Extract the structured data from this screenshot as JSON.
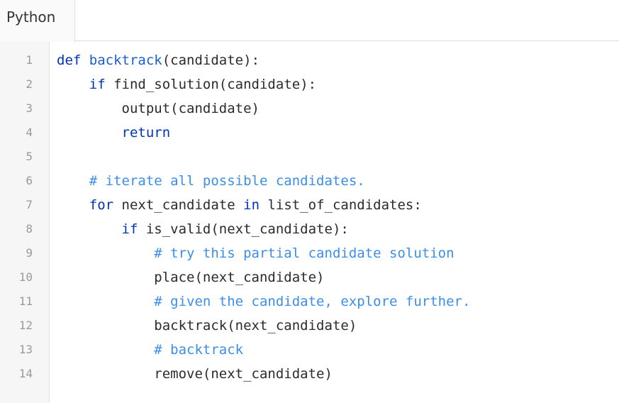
{
  "tab": {
    "label": "Python"
  },
  "code": {
    "line_numbers": [
      "1",
      "2",
      "3",
      "4",
      "5",
      "6",
      "7",
      "8",
      "9",
      "10",
      "11",
      "12",
      "13",
      "14"
    ],
    "l1": {
      "kw": "def",
      "fn": "backtrack",
      "rest": "(candidate):"
    },
    "l2": {
      "kw": "if",
      "rest": " find_solution(candidate):"
    },
    "l3": {
      "rest": "output(candidate)"
    },
    "l4": {
      "kw": "return"
    },
    "l6": {
      "comment": "# iterate all possible candidates."
    },
    "l7": {
      "kw1": "for",
      "mid": " next_candidate ",
      "kw2": "in",
      "rest": " list_of_candidates:"
    },
    "l8": {
      "kw": "if",
      "rest": " is_valid(next_candidate):"
    },
    "l9": {
      "comment": "# try this partial candidate solution"
    },
    "l10": {
      "rest": "place(next_candidate)"
    },
    "l11": {
      "comment": "# given the candidate, explore further."
    },
    "l12": {
      "rest": "backtrack(next_candidate)"
    },
    "l13": {
      "comment": "# backtrack"
    },
    "l14": {
      "rest": "remove(next_candidate)"
    }
  }
}
